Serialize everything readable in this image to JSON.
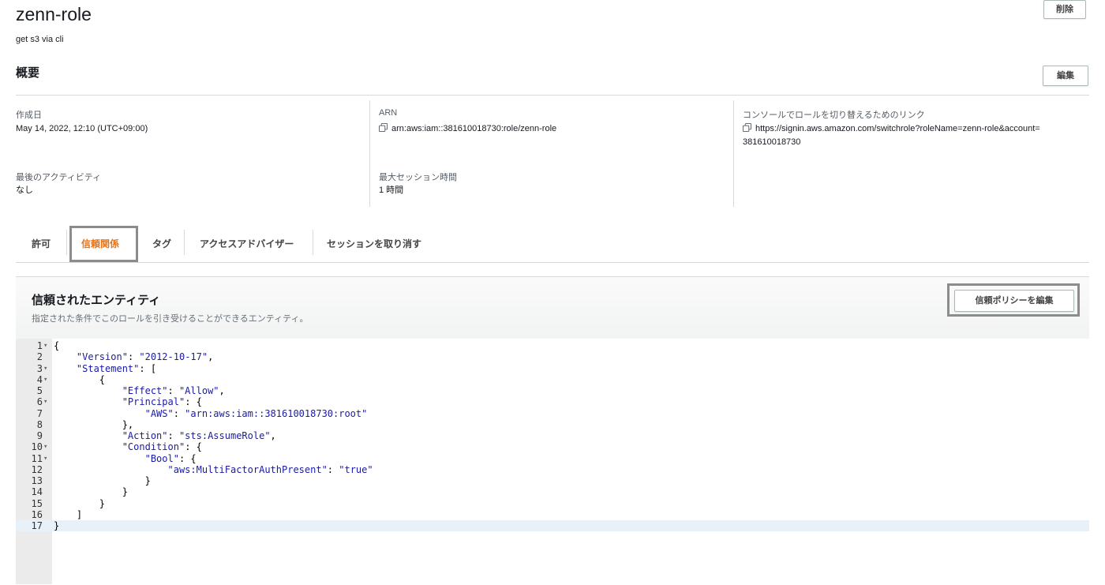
{
  "role": {
    "name": "zenn-role",
    "description": "get s3 via cli"
  },
  "delete_button": "削除",
  "summary": {
    "title": "概要",
    "edit_button": "編集",
    "created_label": "作成日",
    "created_value": "May 14, 2022, 12:10 (UTC+09:00)",
    "arn_label": "ARN",
    "arn_value": "arn:aws:iam::381610018730:role/zenn-role",
    "switch_label": "コンソールでロールを切り替えるためのリンク",
    "switch_value_1": "https://signin.aws.amazon.com/switchrole?roleName=zenn-role&account=",
    "switch_value_2": "381610018730",
    "last_activity_label": "最後のアクティビティ",
    "last_activity_value": "なし",
    "max_session_label": "最大セッション時間",
    "max_session_value": "1 時間"
  },
  "tabs": [
    {
      "label": "許可"
    },
    {
      "label": "信頼関係"
    },
    {
      "label": "タグ"
    },
    {
      "label": "アクセスアドバイザー"
    },
    {
      "label": "セッションを取り消す"
    }
  ],
  "active_tab_color": "#ec7211",
  "trusted_entities": {
    "title": "信頼されたエンティティ",
    "subtitle": "指定された条件でこのロールを引き受けることができるエンティティ。",
    "edit_policy_button": "信頼ポリシーを編集"
  },
  "policy_lines": [
    {
      "n": "1",
      "fold": true,
      "text": "{"
    },
    {
      "n": "2",
      "fold": false,
      "text": "    \"Version\": \"2012-10-17\","
    },
    {
      "n": "3",
      "fold": true,
      "text": "    \"Statement\": ["
    },
    {
      "n": "4",
      "fold": true,
      "text": "        {"
    },
    {
      "n": "5",
      "fold": false,
      "text": "            \"Effect\": \"Allow\","
    },
    {
      "n": "6",
      "fold": true,
      "text": "            \"Principal\": {"
    },
    {
      "n": "7",
      "fold": false,
      "text": "                \"AWS\": \"arn:aws:iam::381610018730:root\""
    },
    {
      "n": "8",
      "fold": false,
      "text": "            },"
    },
    {
      "n": "9",
      "fold": false,
      "text": "            \"Action\": \"sts:AssumeRole\","
    },
    {
      "n": "10",
      "fold": true,
      "text": "            \"Condition\": {"
    },
    {
      "n": "11",
      "fold": true,
      "text": "                \"Bool\": {"
    },
    {
      "n": "12",
      "fold": false,
      "text": "                    \"aws:MultiFactorAuthPresent\": \"true\""
    },
    {
      "n": "13",
      "fold": false,
      "text": "                }"
    },
    {
      "n": "14",
      "fold": false,
      "text": "            }"
    },
    {
      "n": "15",
      "fold": false,
      "text": "        }"
    },
    {
      "n": "16",
      "fold": false,
      "text": "    ]"
    },
    {
      "n": "17",
      "fold": false,
      "text": "}"
    }
  ]
}
